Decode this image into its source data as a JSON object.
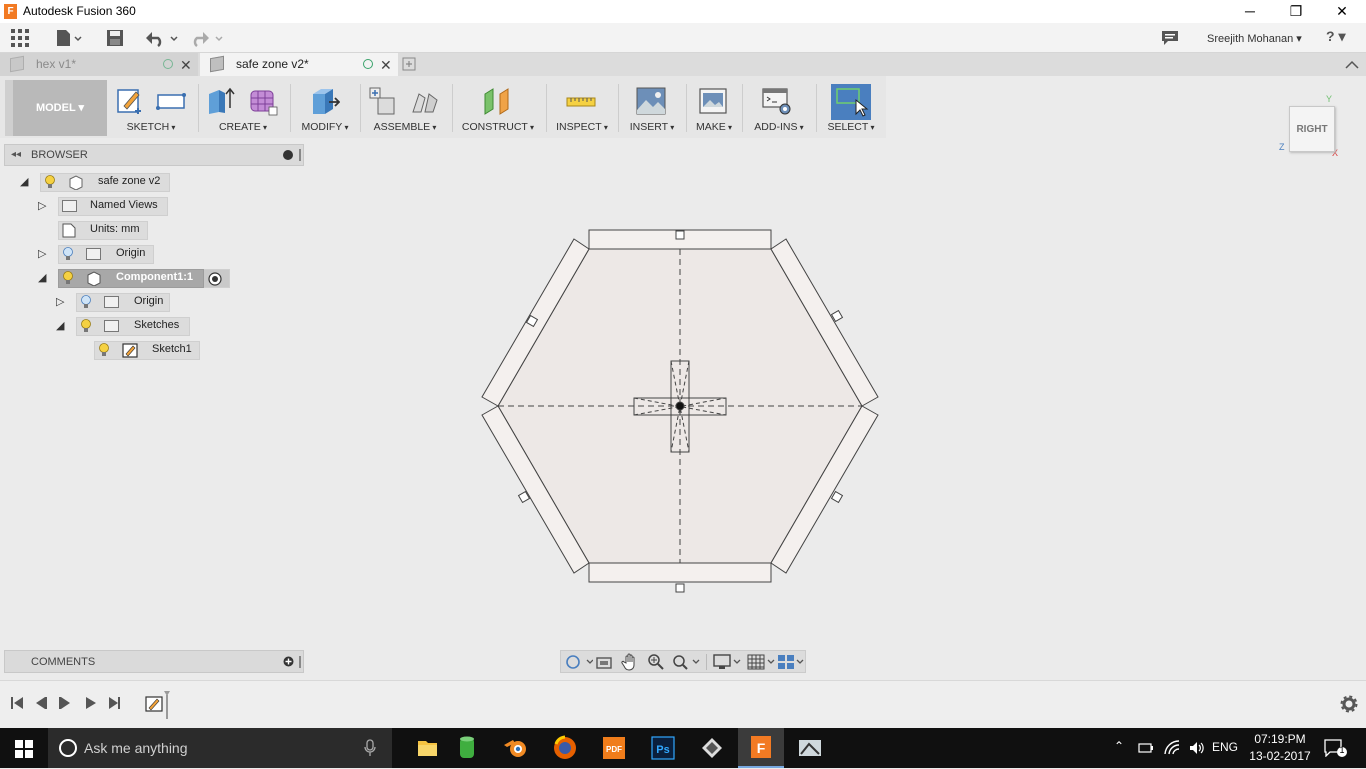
{
  "window": {
    "title": "Autodesk Fusion 360",
    "app_icon_letter": "F",
    "minimize_glyph": "─",
    "maximize_glyph": "❐",
    "close_glyph": "✕"
  },
  "appbar": {
    "user": "Sreejith Mohanan ▾",
    "help": "? ▾"
  },
  "tabs": [
    {
      "label": "hex v1*",
      "active": false
    },
    {
      "label": "safe zone v2*",
      "active": true
    }
  ],
  "toolbar": {
    "mode": "MODEL ▾",
    "groups": [
      "SKETCH",
      "CREATE",
      "MODIFY",
      "ASSEMBLE",
      "CONSTRUCT",
      "INSPECT",
      "INSERT",
      "MAKE",
      "ADD-INS",
      "SELECT"
    ]
  },
  "browser": {
    "title": "BROWSER",
    "tree": [
      {
        "label": "safe zone v2",
        "expanded": true
      },
      {
        "label": "Named Views",
        "expanded": false
      },
      {
        "label": "Units: mm"
      },
      {
        "label": "Origin",
        "expanded": false
      },
      {
        "label": "Component1:1",
        "expanded": true,
        "selected": true
      },
      {
        "label": "Origin",
        "expanded": false
      },
      {
        "label": "Sketches",
        "expanded": true
      },
      {
        "label": "Sketch1"
      }
    ]
  },
  "comments": {
    "title": "COMMENTS"
  },
  "viewcube": {
    "face": "RIGHT",
    "axis_y": "Y",
    "axis_z": "Z",
    "axis_x": "X"
  },
  "taskbar": {
    "search_placeholder": "Ask me anything",
    "language": "ENG",
    "time": "07:19:PM",
    "date": "13-02-2017",
    "notifications": "1"
  },
  "colors": {
    "accent_select": "#4a7fbf",
    "bulb": "#f5d142",
    "taskbar": "#101010"
  }
}
